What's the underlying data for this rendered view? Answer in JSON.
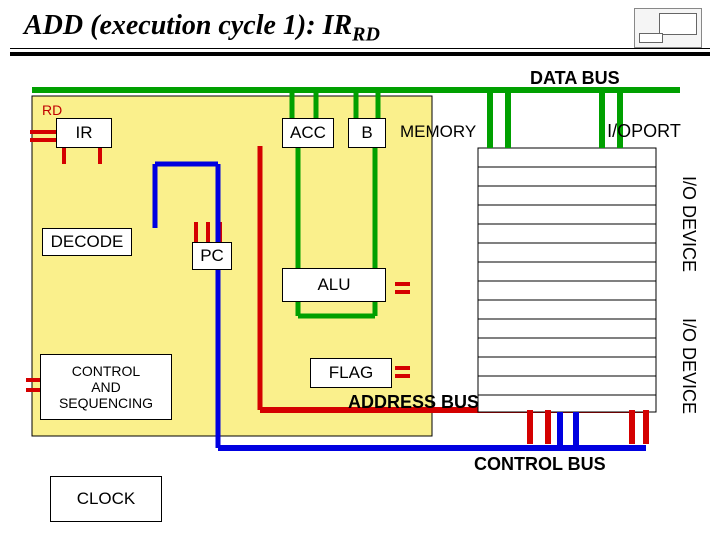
{
  "title_main": "ADD (execution cycle 1): IR",
  "title_sub": "RD",
  "boxes": {
    "ir": "IR",
    "acc": "ACC",
    "b": "B",
    "pc": "PC",
    "alu": "ALU",
    "flag": "FLAG",
    "decode": "DECODE",
    "control_l1": "CONTROL",
    "control_l2": "AND",
    "control_l3": "SEQUENCING",
    "clock": "CLOCK",
    "memory": "MEMORY",
    "ioport_l1": "I/O",
    "ioport_l2": "PORT",
    "iodevice": "I/O DEVICE"
  },
  "buses": {
    "data": "DATA BUS",
    "address": "ADDRESS BUS",
    "control": "CONTROL BUS"
  },
  "annotations": {
    "rd": "RD"
  },
  "colors": {
    "yellow_region": "#faf08c",
    "green": "#00a000",
    "red": "#d40000",
    "blue": "#0000e0"
  }
}
